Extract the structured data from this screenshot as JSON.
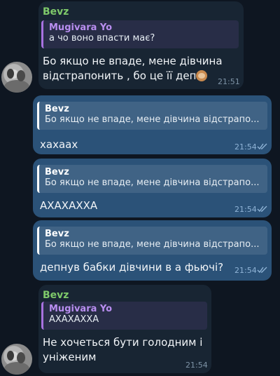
{
  "messages": [
    {
      "sender": "Bevz",
      "reply_name": "Mugivara Yo",
      "reply_text": "а чо воно впасти має?",
      "line1": "Бо якщо не впаде, мене дівчина",
      "line2": "відстрапонить , бо це її деп",
      "emoji_icon": "monkey-see-no-evil-icon",
      "time": "21:51"
    },
    {
      "reply_name": "Bevz",
      "reply_text": "Бо якщо не впаде, мене дівчина відстрапо...",
      "text": "хахаах",
      "time": "21:54"
    },
    {
      "reply_name": "Bevz",
      "reply_text": "Бо якщо не впаде, мене дівчина відстрапо...",
      "text": "АХАХАХХА",
      "time": "21:54"
    },
    {
      "reply_name": "Bevz",
      "reply_text": "Бо якщо не впаде, мене дівчина відстрапо...",
      "text": "депнув бабки дівчини в а фьючі?",
      "time": "21:54"
    },
    {
      "sender": "Bevz",
      "reply_name": "Mugivara Yo",
      "reply_text": "АХАХАХХА",
      "line1": "Не хочеться бути голодним і",
      "line2": "уніженим",
      "time": "21:54"
    }
  ],
  "colors": {
    "background": "#0e1621",
    "incoming_bubble": "#182533",
    "outgoing_bubble": "#2b5278",
    "sender_name": "#7ec96a",
    "reply_accent_incoming": "#a872e0"
  }
}
